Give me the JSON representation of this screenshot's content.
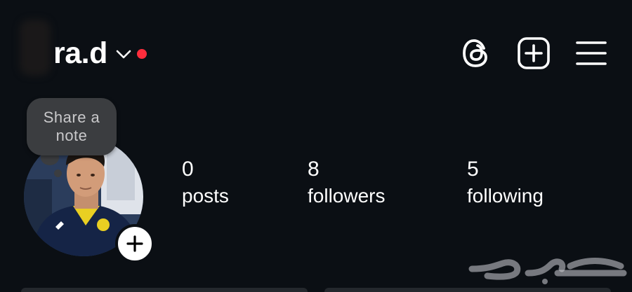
{
  "header": {
    "username": "ra.d",
    "icons": [
      "chevron-down-icon",
      "notification-dot",
      "threads-icon",
      "new-post-icon",
      "menu-icon"
    ],
    "notification_color": "#ff2d3c"
  },
  "note": {
    "text": "Share a note"
  },
  "profile": {
    "avatar_icon": "profile-photo",
    "add_story_icon": "plus-icon"
  },
  "stats": {
    "posts": {
      "count": "0",
      "label": "posts"
    },
    "followers": {
      "count": "8",
      "label": "followers"
    },
    "following": {
      "count": "5",
      "label": "following"
    }
  },
  "watermark": {
    "icon": "haraj-watermark"
  }
}
